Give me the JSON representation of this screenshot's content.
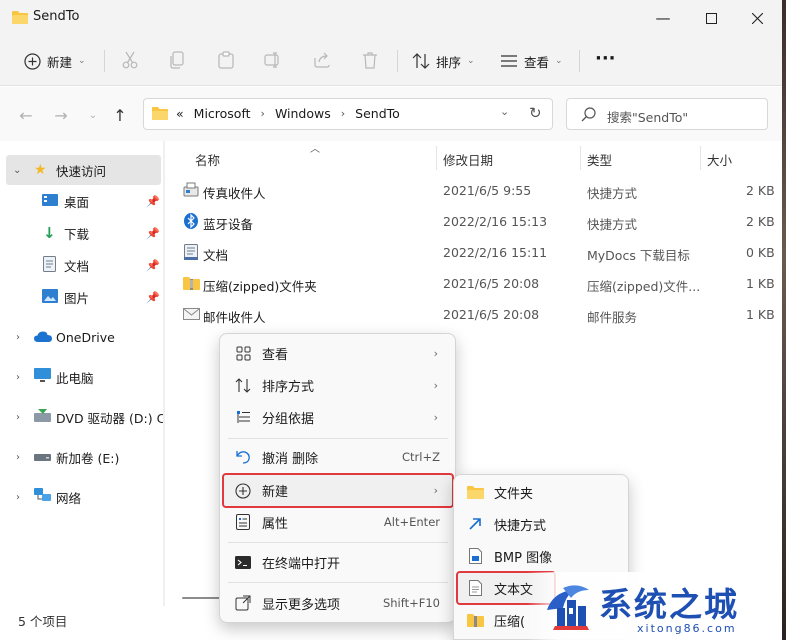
{
  "window": {
    "title": "SendTo"
  },
  "toolbar": {
    "new_label": "新建",
    "sort_label": "排序",
    "view_label": "查看",
    "more_label": "···"
  },
  "address": {
    "prefix": "«",
    "crumbs": [
      "Microsoft",
      "Windows",
      "SendTo"
    ]
  },
  "search": {
    "placeholder": "搜索\"SendTo\""
  },
  "sidebar": {
    "items": [
      {
        "label": "快速访问"
      },
      {
        "label": "桌面"
      },
      {
        "label": "下载"
      },
      {
        "label": "文档"
      },
      {
        "label": "图片"
      },
      {
        "label": "OneDrive"
      },
      {
        "label": "此电脑"
      },
      {
        "label": "DVD 驱动器 (D:) CC"
      },
      {
        "label": "新加卷 (E:)"
      },
      {
        "label": "网络"
      }
    ]
  },
  "columns": {
    "name": "名称",
    "date": "修改日期",
    "type": "类型",
    "size": "大小"
  },
  "files": [
    {
      "name": "传真收件人",
      "date": "2021/6/5 9:55",
      "type": "快捷方式",
      "size": "2 KB",
      "icon": "fax-icon"
    },
    {
      "name": "蓝牙设备",
      "date": "2022/2/16 15:13",
      "type": "快捷方式",
      "size": "2 KB",
      "icon": "bluetooth-icon"
    },
    {
      "name": "文档",
      "date": "2022/2/16 15:11",
      "type": "MyDocs 下载目标",
      "size": "0 KB",
      "icon": "documents-icon"
    },
    {
      "name": "压缩(zipped)文件夹",
      "date": "2021/6/5 20:08",
      "type": "压缩(zipped)文件...",
      "size": "1 KB",
      "icon": "zip-folder-icon"
    },
    {
      "name": "邮件收件人",
      "date": "2021/6/5 20:08",
      "type": "邮件服务",
      "size": "1 KB",
      "icon": "mail-icon"
    }
  ],
  "status": {
    "count": "5 个项目"
  },
  "context_menu": {
    "view": "查看",
    "sort": "排序方式",
    "group": "分组依据",
    "undo": "撤消 删除",
    "undo_shortcut": "Ctrl+Z",
    "new": "新建",
    "properties": "属性",
    "properties_shortcut": "Alt+Enter",
    "terminal": "在终端中打开",
    "more": "显示更多选项",
    "more_shortcut": "Shift+F10"
  },
  "submenu": {
    "folder": "文件夹",
    "shortcut": "快捷方式",
    "bmp": "BMP 图像",
    "text": "文本文",
    "zip": "压缩("
  },
  "watermark": {
    "title": "系统之城",
    "url": "xitong86.com"
  },
  "colors": {
    "accent": "#0067c0",
    "highlight": "#e0393e",
    "folder": "#f8c642",
    "watermark": "#1e4fb3"
  }
}
